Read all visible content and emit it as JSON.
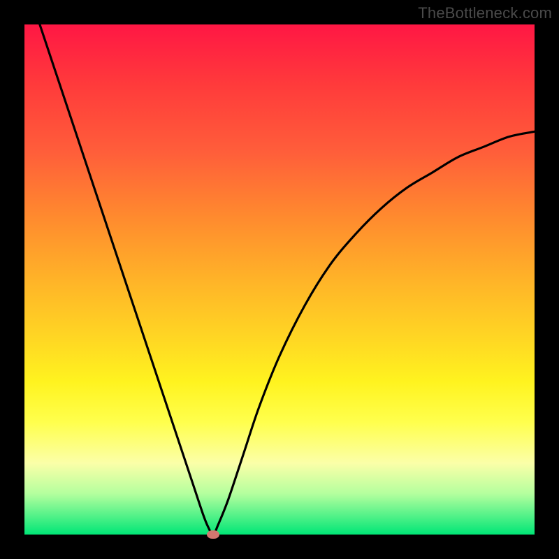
{
  "watermark": "TheBottleneck.com",
  "colors": {
    "frame": "#000000",
    "gradient_top": "#ff1744",
    "gradient_bottom": "#00e676",
    "curve": "#000000",
    "marker": "#d1776f"
  },
  "chart_data": {
    "type": "line",
    "title": "",
    "xlabel": "",
    "ylabel": "",
    "xlim": [
      0,
      100
    ],
    "ylim": [
      0,
      100
    ],
    "grid": false,
    "legend": false,
    "series": [
      {
        "name": "bottleneck-curve",
        "x": [
          3,
          6,
          9,
          12,
          15,
          18,
          21,
          24,
          27,
          30,
          33,
          35,
          36,
          37,
          38,
          40,
          43,
          46,
          50,
          55,
          60,
          65,
          70,
          75,
          80,
          85,
          90,
          95,
          100
        ],
        "y": [
          100,
          91,
          82,
          73,
          64,
          55,
          46,
          37,
          28,
          19,
          10,
          4,
          1.5,
          0,
          2,
          7,
          16,
          25,
          35,
          45,
          53,
          59,
          64,
          68,
          71,
          74,
          76,
          78,
          79
        ]
      }
    ],
    "marker": {
      "x": 37,
      "y": 0
    }
  }
}
